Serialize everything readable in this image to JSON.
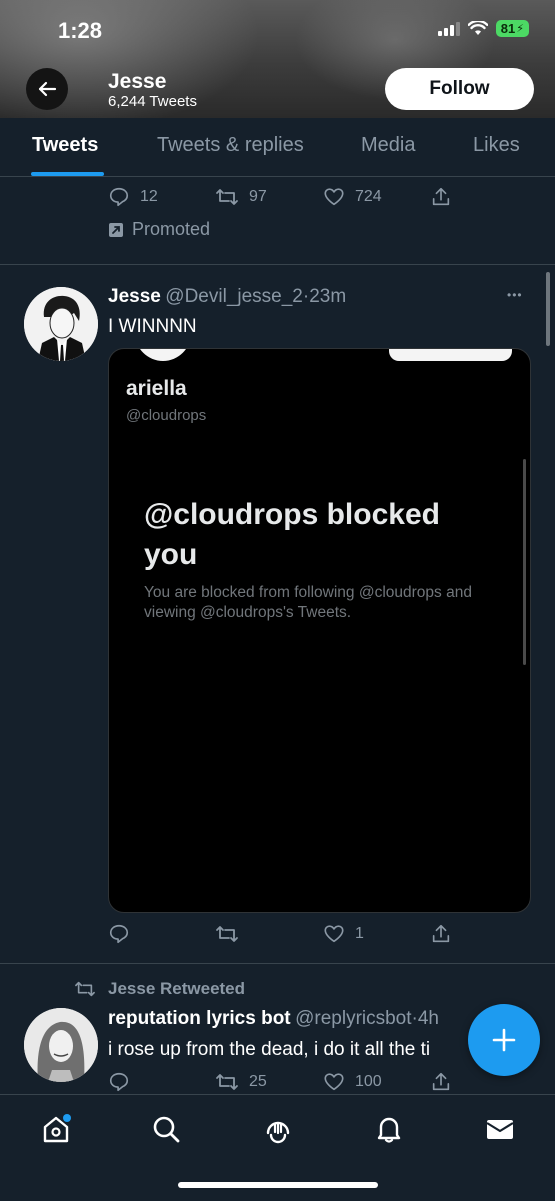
{
  "status_bar": {
    "time": "1:28",
    "battery": "81"
  },
  "header": {
    "name": "Jesse",
    "tweet_count": "6,244 Tweets",
    "follow_label": "Follow"
  },
  "tabs": [
    {
      "label": "Tweets",
      "active": true
    },
    {
      "label": "Tweets & replies",
      "active": false
    },
    {
      "label": "Media",
      "active": false
    },
    {
      "label": "Likes",
      "active": false
    }
  ],
  "promoted_tweet": {
    "replies": "12",
    "retweets": "97",
    "likes": "724",
    "promoted_label": "Promoted"
  },
  "tweet1": {
    "name": "Jesse",
    "handle": "@Devil_jesse_2",
    "sep": "·",
    "time": "23m",
    "text": "I WINNNN",
    "more": "•••",
    "media": {
      "profile_name": "ariella",
      "profile_handle": "@cloudrops",
      "blocked_title": "@cloudrops blocked you",
      "blocked_desc": "You are blocked from following @cloudrops and viewing @cloudrops's Tweets."
    },
    "replies": "",
    "retweets": "",
    "likes": "1"
  },
  "tweet2": {
    "retweeted_by": "Jesse Retweeted",
    "name": "reputation lyrics bot",
    "handle": "@replyricsbot",
    "sep": "·",
    "time": "4h",
    "text": "i rose up from the dead, i do it all the ti",
    "retweets": "25",
    "likes": "100"
  },
  "colors": {
    "accent": "#1d9bf0",
    "background": "#15202b",
    "muted": "#8b98a5"
  },
  "bottom_nav": [
    "home-icon",
    "search-icon",
    "spaces-icon",
    "notifications-icon",
    "messages-icon"
  ]
}
